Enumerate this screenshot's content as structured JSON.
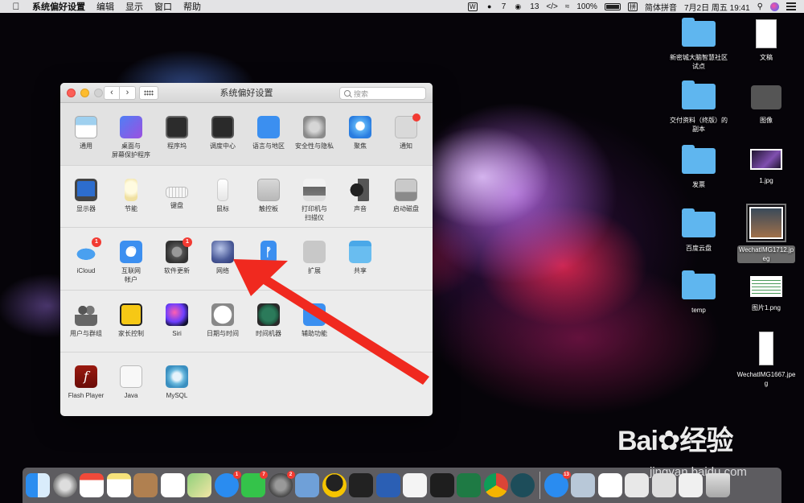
{
  "menubar": {
    "app_name": "系统偏好设置",
    "menus": [
      "编辑",
      "显示",
      "窗口",
      "帮助"
    ],
    "status": {
      "badge_count_1": "7",
      "badge_count_2": "13",
      "battery": "100%",
      "input_method": "简体拼音",
      "datetime": "7月2日 周五  19:41"
    }
  },
  "window": {
    "title": "系统偏好设置",
    "search_placeholder": "搜索",
    "sections": [
      [
        {
          "label": "通用",
          "icon": "general-icon"
        },
        {
          "label": "桌面与\n屏幕保护程序",
          "icon": "desktop-icon"
        },
        {
          "label": "程序坞",
          "icon": "mission-control-icon"
        },
        {
          "label": "调度中心",
          "icon": "dock-icon"
        },
        {
          "label": "语言与地区",
          "icon": "flag-icon"
        },
        {
          "label": "安全性与隐私",
          "icon": "house-lock-icon"
        },
        {
          "label": "聚焦",
          "icon": "spotlight-icon"
        },
        {
          "label": "通知",
          "icon": "notification-icon"
        }
      ],
      [
        {
          "label": "显示器",
          "icon": "display-icon"
        },
        {
          "label": "节能",
          "icon": "lightbulb-icon"
        },
        {
          "label": "键盘",
          "icon": "keyboard-icon"
        },
        {
          "label": "鼠标",
          "icon": "mouse-icon"
        },
        {
          "label": "触控板",
          "icon": "trackpad-icon"
        },
        {
          "label": "打印机与\n扫描仪",
          "icon": "printer-icon"
        },
        {
          "label": "声音",
          "icon": "speaker-icon"
        },
        {
          "label": "启动磁盘",
          "icon": "disk-icon"
        }
      ],
      [
        {
          "label": "iCloud",
          "icon": "icloud-icon",
          "badge": "1"
        },
        {
          "label": "互联网\n帐户",
          "icon": "at-icon"
        },
        {
          "label": "软件更新",
          "icon": "gear-update-icon",
          "badge": "1"
        },
        {
          "label": "网络",
          "icon": "network-globe-icon"
        },
        {
          "label": "蓝牙",
          "icon": "bluetooth-icon"
        },
        {
          "label": "扩展",
          "icon": "puzzle-icon"
        },
        {
          "label": "共享",
          "icon": "sharing-folder-icon"
        }
      ],
      [
        {
          "label": "用户与群组",
          "icon": "users-icon"
        },
        {
          "label": "家长控制",
          "icon": "parental-control-icon"
        },
        {
          "label": "Siri",
          "icon": "siri-icon"
        },
        {
          "label": "日期与时间",
          "icon": "clock-icon"
        },
        {
          "label": "时间机器",
          "icon": "time-machine-icon"
        },
        {
          "label": "辅助功能",
          "icon": "accessibility-icon"
        }
      ],
      [
        {
          "label": "Flash Player",
          "icon": "flash-icon"
        },
        {
          "label": "Java",
          "icon": "java-icon"
        },
        {
          "label": "MySQL",
          "icon": "mysql-icon"
        }
      ]
    ]
  },
  "desktop": {
    "items": [
      {
        "label": "新密城大脑智慧社区\n试点",
        "kind": "folder"
      },
      {
        "label": "文稿",
        "kind": "doc"
      },
      {
        "label": "交付资料（终版）的\n副本",
        "kind": "folder"
      },
      {
        "label": "图像",
        "kind": "dvd"
      },
      {
        "label": "发票",
        "kind": "folder"
      },
      {
        "label": "1.jpg",
        "kind": "thumb"
      },
      {
        "label": "百度云盘",
        "kind": "folder"
      },
      {
        "label": "WechatIMG1712.jp\neg",
        "kind": "thumb-selected"
      },
      {
        "label": "temp",
        "kind": "folder"
      },
      {
        "label": "图片1.png",
        "kind": "thumb-table"
      },
      {
        "label": "WechatIMG1667.jpe\ng",
        "kind": "doc"
      }
    ]
  },
  "dock": {
    "badges": {
      "appstore": "1",
      "wechat": "7",
      "prefs": "2",
      "dingtalk": "13"
    }
  },
  "watermark": {
    "brand": "Bai",
    "suffix": "经验",
    "url": "jingyan.baidu.com"
  },
  "colors": {
    "arrow": "#f0291f",
    "folder": "#5fb6ef",
    "badge": "#f23a32"
  }
}
